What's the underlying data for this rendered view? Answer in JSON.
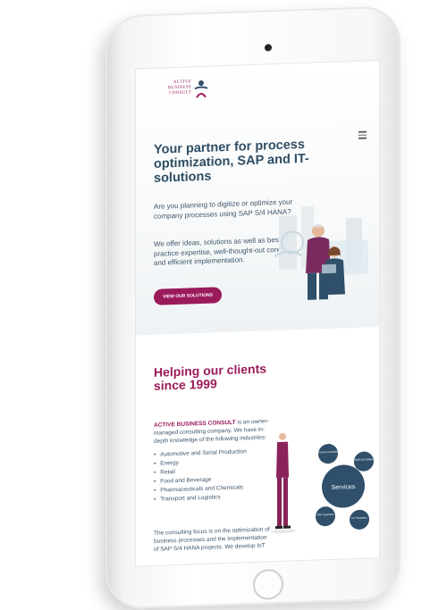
{
  "logo": {
    "text_line1": "ACTIVE",
    "text_line2": "BUSINESS",
    "text_line3": "CONSULT"
  },
  "hero": {
    "headline": "Your partner for process optimization, SAP and IT-solutions",
    "para1": "Are you planning to digitize or optimize your company processes using SAP S/4 HANA?",
    "para2": "We offer ideas, solutions as well as best practice expertise, well-thought-out concepts and efficient implementation.",
    "cta_label": "VIEW OUR SOLUTIONS"
  },
  "section2": {
    "heading": "Helping our clients since 1999",
    "intro_brand": "ACTIVE BUSINESS CONSULT",
    "intro_rest": " is an owner-managed consulting company. We have in-depth knowledge of the following industries:",
    "industries": [
      "Automotive and Serial Production",
      "Energy",
      "Retail",
      "Food and Beverage",
      "Pharmaceuticals and Chemicals",
      "Transport and Logistics"
    ],
    "focus": "The consulting focus is on the optimization of business processes and the implementation of SAP S/4 HANA projects. We develop IoT",
    "services": {
      "center": "Services",
      "nodes": [
        "Process Consulting",
        "SAP S/4 HANA",
        "SAP Solutions",
        "IoT Solutions"
      ]
    }
  },
  "colors": {
    "brand": "#9a1b5a",
    "navy": "#2e4d63",
    "circle": "#2f4f6a"
  }
}
